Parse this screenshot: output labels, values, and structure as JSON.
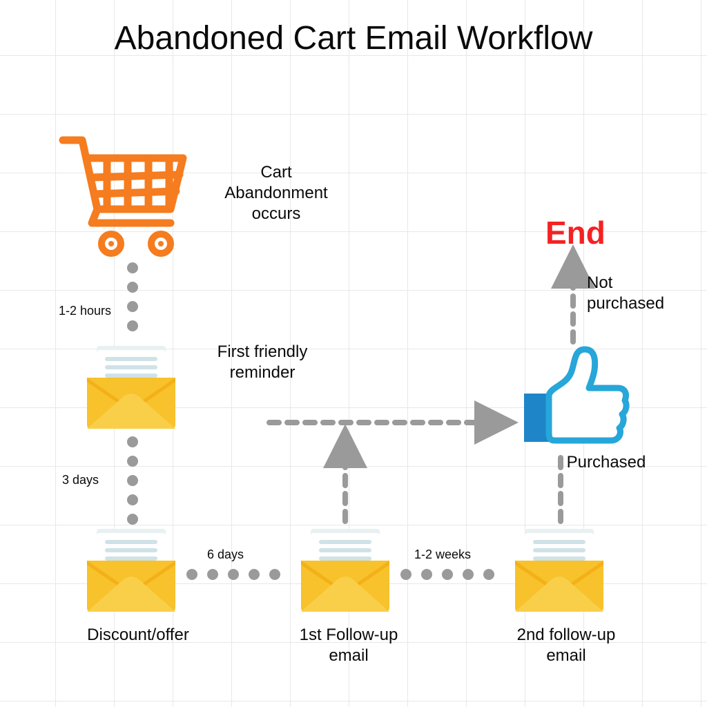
{
  "title": "Abandoned Cart Email Workflow",
  "nodes": {
    "start": {
      "label": "Cart Abandonment occurs"
    },
    "email1": {
      "label": "First friendly reminder"
    },
    "email2": {
      "label": "Discount/offer"
    },
    "email3": {
      "label": "1st Follow-up email"
    },
    "email4": {
      "label": "2nd follow-up email"
    },
    "purchased": {
      "label": "Purchased"
    },
    "not_purchased": {
      "label": "Not purchased"
    },
    "end": {
      "label": "End"
    }
  },
  "timings": {
    "t1": "1-2 hours",
    "t2": "3 days",
    "t3": "6  days",
    "t4": "1-2 weeks"
  },
  "colors": {
    "cart": "#f57c1f",
    "envelope_body": "#f7c22b",
    "envelope_flap": "#f3b018",
    "paper": "#ffffff",
    "paper_line": "#cfe2e7",
    "paper_top": "#e9f0f2",
    "thumb_stroke": "#27a6d9",
    "thumb_cuff": "#1e85c8",
    "end_text": "#f32323",
    "arrow": "#9a9a9a",
    "dot": "#9a9a9a"
  }
}
